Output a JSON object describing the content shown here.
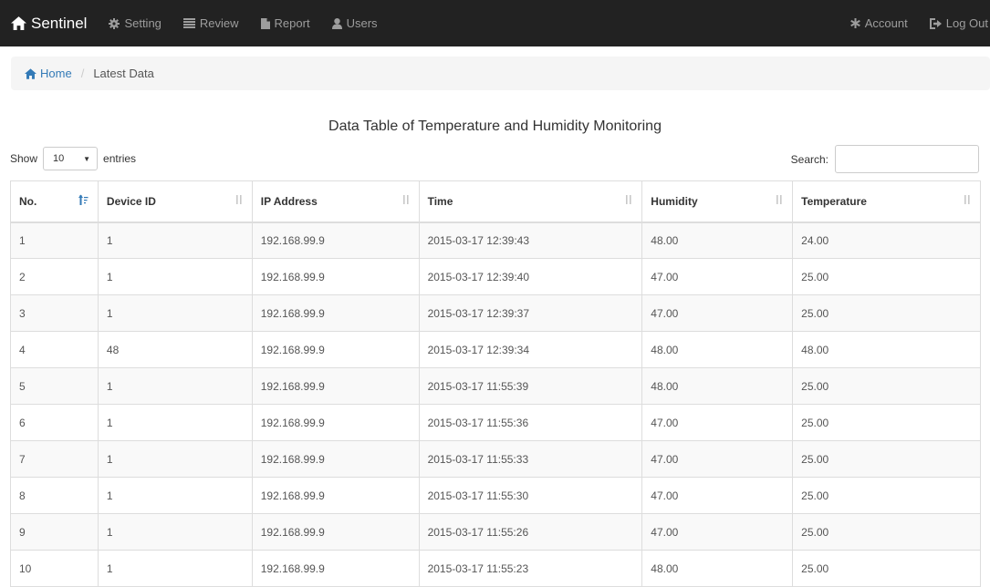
{
  "navbar": {
    "brand": "Sentinel",
    "items": [
      {
        "label": "Setting",
        "icon": "cog-icon"
      },
      {
        "label": "Review",
        "icon": "list-icon"
      },
      {
        "label": "Report",
        "icon": "file-icon"
      },
      {
        "label": "Users",
        "icon": "user-icon"
      }
    ],
    "right_items": [
      {
        "label": "Account",
        "icon": "asterisk-icon"
      },
      {
        "label": "Log Out",
        "icon": "log-out-icon"
      }
    ]
  },
  "breadcrumb": {
    "home": "Home",
    "separator": "/",
    "current": "Latest Data"
  },
  "table_title": "Data Table of Temperature and Humidity Monitoring",
  "controls": {
    "show_label": "Show",
    "page_length": "10",
    "entries_label": "entries",
    "search_label": "Search:",
    "search_value": ""
  },
  "table": {
    "columns": [
      "No.",
      "Device ID",
      "IP Address",
      "Time",
      "Humidity",
      "Temperature"
    ],
    "sorted_column": "No.",
    "rows": [
      [
        "1",
        "1",
        "192.168.99.9",
        "2015-03-17 12:39:43",
        "48.00",
        "24.00"
      ],
      [
        "2",
        "1",
        "192.168.99.9",
        "2015-03-17 12:39:40",
        "47.00",
        "25.00"
      ],
      [
        "3",
        "1",
        "192.168.99.9",
        "2015-03-17 12:39:37",
        "47.00",
        "25.00"
      ],
      [
        "4",
        "48",
        "192.168.99.9",
        "2015-03-17 12:39:34",
        "48.00",
        "48.00"
      ],
      [
        "5",
        "1",
        "192.168.99.9",
        "2015-03-17 11:55:39",
        "48.00",
        "25.00"
      ],
      [
        "6",
        "1",
        "192.168.99.9",
        "2015-03-17 11:55:36",
        "47.00",
        "25.00"
      ],
      [
        "7",
        "1",
        "192.168.99.9",
        "2015-03-17 11:55:33",
        "47.00",
        "25.00"
      ],
      [
        "8",
        "1",
        "192.168.99.9",
        "2015-03-17 11:55:30",
        "47.00",
        "25.00"
      ],
      [
        "9",
        "1",
        "192.168.99.9",
        "2015-03-17 11:55:26",
        "47.00",
        "25.00"
      ],
      [
        "10",
        "1",
        "192.168.99.9",
        "2015-03-17 11:55:23",
        "48.00",
        "25.00"
      ]
    ]
  },
  "colors": {
    "navbar_bg": "#222222",
    "nav_text": "#9d9d9d",
    "link": "#337ab7",
    "stripe": "#f9f9f9",
    "border": "#dddddd"
  }
}
